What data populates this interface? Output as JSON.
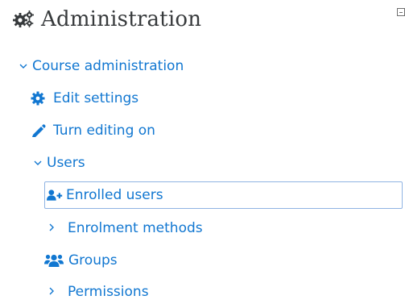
{
  "header": {
    "title": "Administration",
    "icon": "gears-icon"
  },
  "nav": {
    "course_admin": {
      "label": "Course administration",
      "expanded": true
    },
    "edit_settings": {
      "label": "Edit settings",
      "icon": "gear-icon"
    },
    "turn_editing": {
      "label": "Turn editing on",
      "icon": "pencil-icon"
    },
    "users": {
      "label": "Users",
      "expanded": true
    },
    "enrolled_users": {
      "label": "Enrolled users",
      "icon": "user-plus-icon",
      "selected": true
    },
    "enrolment_methods": {
      "label": "Enrolment methods",
      "expanded": false
    },
    "groups": {
      "label": "Groups",
      "icon": "users-icon"
    },
    "permissions": {
      "label": "Permissions",
      "expanded": false
    }
  },
  "colors": {
    "link": "#1177d1",
    "heading": "#373a3c",
    "selected_border": "#8fb3e3"
  }
}
